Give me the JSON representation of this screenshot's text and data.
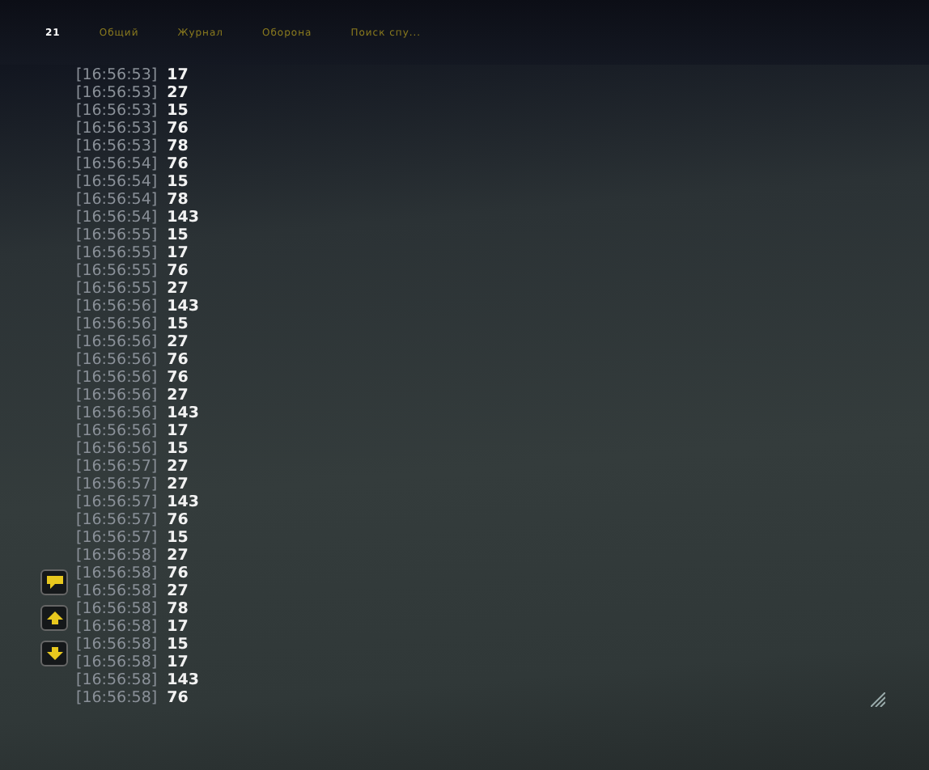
{
  "tabs": [
    {
      "label": "21",
      "selected": true
    },
    {
      "label": "Общий",
      "selected": false
    },
    {
      "label": "Журнал",
      "selected": false
    },
    {
      "label": "Оборона",
      "selected": false
    },
    {
      "label": "Поиск спу...",
      "selected": false
    }
  ],
  "messages": [
    {
      "time": "[16:56:53]",
      "text": "17"
    },
    {
      "time": "[16:56:53]",
      "text": "27"
    },
    {
      "time": "[16:56:53]",
      "text": "15"
    },
    {
      "time": "[16:56:53]",
      "text": "76"
    },
    {
      "time": "[16:56:53]",
      "text": "78"
    },
    {
      "time": "[16:56:54]",
      "text": "76"
    },
    {
      "time": "[16:56:54]",
      "text": "15"
    },
    {
      "time": "[16:56:54]",
      "text": "78"
    },
    {
      "time": "[16:56:54]",
      "text": "143"
    },
    {
      "time": "[16:56:55]",
      "text": "15"
    },
    {
      "time": "[16:56:55]",
      "text": "17"
    },
    {
      "time": "[16:56:55]",
      "text": "76"
    },
    {
      "time": "[16:56:55]",
      "text": "27"
    },
    {
      "time": "[16:56:56]",
      "text": "143"
    },
    {
      "time": "[16:56:56]",
      "text": "15"
    },
    {
      "time": "[16:56:56]",
      "text": "27"
    },
    {
      "time": "[16:56:56]",
      "text": "76"
    },
    {
      "time": "[16:56:56]",
      "text": "76"
    },
    {
      "time": "[16:56:56]",
      "text": "27"
    },
    {
      "time": "[16:56:56]",
      "text": "143"
    },
    {
      "time": "[16:56:56]",
      "text": "17"
    },
    {
      "time": "[16:56:56]",
      "text": "15"
    },
    {
      "time": "[16:56:57]",
      "text": "27"
    },
    {
      "time": "[16:56:57]",
      "text": "27"
    },
    {
      "time": "[16:56:57]",
      "text": "143"
    },
    {
      "time": "[16:56:57]",
      "text": "76"
    },
    {
      "time": "[16:56:57]",
      "text": "15"
    },
    {
      "time": "[16:56:58]",
      "text": "27"
    },
    {
      "time": "[16:56:58]",
      "text": "76"
    },
    {
      "time": "[16:56:58]",
      "text": "27"
    },
    {
      "time": "[16:56:58]",
      "text": "78"
    },
    {
      "time": "[16:56:58]",
      "text": "17"
    },
    {
      "time": "[16:56:58]",
      "text": "15"
    },
    {
      "time": "[16:56:58]",
      "text": "17"
    },
    {
      "time": "[16:56:58]",
      "text": "143"
    },
    {
      "time": "[16:56:58]",
      "text": "76"
    }
  ]
}
